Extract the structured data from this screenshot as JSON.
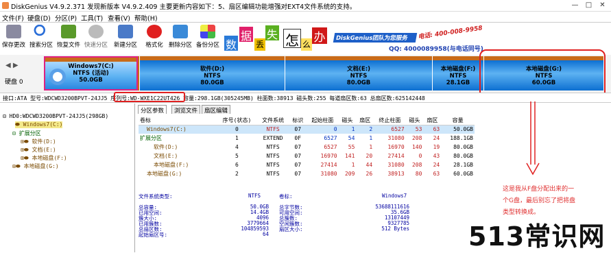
{
  "title": "DiskGenius V4.9.2.371  发现新版本 V4.9.2.409 主要更新内容如下：5、扇区编辑功能增强对EXT4文件系统的支持。",
  "menu": [
    "文件(F)",
    "硬盘(D)",
    "分区(P)",
    "工具(T)",
    "查看(V)",
    "帮助(H)"
  ],
  "toolbar": [
    "保存更改",
    "搜索分区",
    "恢复文件",
    "快速分区",
    "新建分区",
    "格式化",
    "删除分区",
    "备份分区"
  ],
  "banner": {
    "chars": [
      "数",
      "据",
      "丢",
      "失",
      "怎",
      "么",
      "办"
    ],
    "team": "DiskGenius团队为您服务",
    "phone": "电话: 400-008-9958",
    "qq": "QQ: 4000089958(与电话同号)"
  },
  "disk_label": "硬盘 0",
  "partitions": [
    {
      "name": "Windows7(C:)",
      "fs": "NTFS (活动)",
      "size": "50.0GB"
    },
    {
      "name": "",
      "fs": "",
      "size": ""
    },
    {
      "name": "软件(D:)",
      "fs": "NTFS",
      "size": "80.0GB"
    },
    {
      "name": "文档(E:)",
      "fs": "NTFS",
      "size": "80.0GB"
    },
    {
      "name": "本地磁盘(F:)",
      "fs": "NTFS",
      "size": "28.1GB"
    },
    {
      "name": "本地磁盘(G:)",
      "fs": "NTFS",
      "size": "60.0GB"
    }
  ],
  "infobar": "接口:ATA  型号:WDCWD3200BPVT-24JJ5  序列号:WD-WXE1C22UT426  容量:298.1GB(305245MB)  柱面数:38913  磁头数:255  每道扇区数:63  总扇区数:625142448",
  "tree": {
    "disk": "HD0:WDCWD3200BPVT-24JJ5(298GB)",
    "items": [
      "Windows7(C:)",
      "扩展分区",
      "软件(D:)",
      "文档(E:)",
      "本地磁盘(F:)",
      "本地磁盘(G:)"
    ]
  },
  "tabs": [
    "分区参数",
    "浏览文件",
    "扇区编辑"
  ],
  "table": {
    "headers": [
      "卷标",
      "序号(状态)",
      "文件系统",
      "标识",
      "起始柱面",
      "磁头",
      "扇区",
      "终止柱面",
      "磁头",
      "扇区",
      "容量"
    ],
    "rows": [
      [
        "Windows7(C:)",
        "0",
        "NTFS",
        "07",
        "0",
        "1",
        "2",
        "6527",
        "53",
        "63",
        "50.0GB"
      ],
      [
        "扩展分区",
        "1",
        "EXTEND",
        "0F",
        "6527",
        "54",
        "1",
        "31080",
        "208",
        "24",
        "188.1GB"
      ],
      [
        "软件(D:)",
        "4",
        "NTFS",
        "07",
        "6527",
        "55",
        "1",
        "16970",
        "140",
        "19",
        "80.0GB"
      ],
      [
        "文档(E:)",
        "5",
        "NTFS",
        "07",
        "16970",
        "141",
        "20",
        "27414",
        "0",
        "43",
        "80.0GB"
      ],
      [
        "本地磁盘(F:)",
        "6",
        "NTFS",
        "07",
        "27414",
        "1",
        "44",
        "31080",
        "208",
        "24",
        "28.1GB"
      ],
      [
        "本地磁盘(G:)",
        "2",
        "NTFS",
        "07",
        "31080",
        "209",
        "26",
        "38913",
        "80",
        "63",
        "60.0GB"
      ]
    ]
  },
  "stats": {
    "fs_type_label": "文件系统类型:",
    "fs_type": "NTFS",
    "vol_label": "卷标:",
    "vol": "Windows7",
    "left": [
      [
        "总容量:",
        "50.0GB"
      ],
      [
        "已用空间:",
        "14.4GB"
      ],
      [
        "簇大小:",
        "4096"
      ],
      [
        "已用簇数:",
        "3779664"
      ],
      [
        "总扇区数:",
        "104859593"
      ],
      [
        "起始扇区号:",
        "64"
      ]
    ],
    "right": [
      [
        "总字节数:",
        "53688111616"
      ],
      [
        "可用空间:",
        "35.6GB"
      ],
      [
        "总簇数:",
        "13107449"
      ],
      [
        "空闲簇数:",
        "9327785"
      ],
      [
        "扇区大小:",
        "512 Bytes"
      ]
    ]
  },
  "note": "这是我从F盘分配出来的一个G盘，最后别忘了把将盘类型转换成。",
  "watermark": "513常识网"
}
